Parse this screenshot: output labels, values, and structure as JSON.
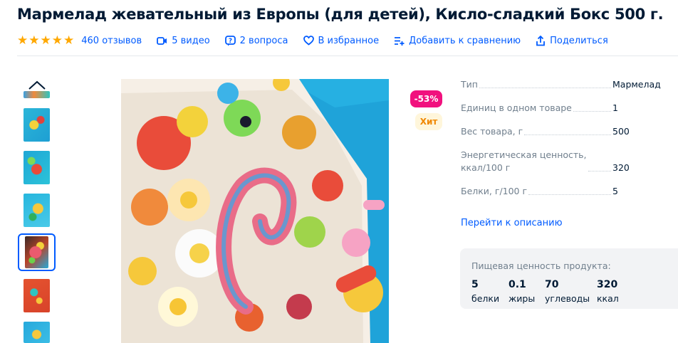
{
  "product": {
    "title": "Мармелад жевательный из Европы (для детей), Кисло-сладкий Бокс 500 г."
  },
  "meta": {
    "rating_stars": 5,
    "reviews": "460 отзывов",
    "videos": "5 видео",
    "questions": "2 вопроса",
    "favorite": "В избранное",
    "compare": "Добавить к сравнению",
    "share": "Поделиться"
  },
  "badges": {
    "discount": "-53%",
    "hit": "Хит"
  },
  "specs": [
    {
      "name": "Тип",
      "value": "Мармелад"
    },
    {
      "name": "Единиц в одном товаре",
      "value": "1"
    },
    {
      "name": "Вес товара, г",
      "value": "500"
    },
    {
      "name": "Энергетическая ценность,",
      "name2": "ккал/100 г",
      "value": "320"
    },
    {
      "name": "Белки, г/100 г",
      "value": "5"
    }
  ],
  "goto_description": "Перейти к описанию",
  "nutrition": {
    "title": "Пищевая ценность продукта:",
    "items": [
      {
        "value": "5",
        "label": "белки"
      },
      {
        "value": "0.1",
        "label": "жиры"
      },
      {
        "value": "70",
        "label": "углеводы"
      },
      {
        "value": "320",
        "label": "ккал"
      }
    ]
  },
  "colors": {
    "accent": "#005bff",
    "discount": "#f1117e",
    "star": "#ffa800"
  }
}
